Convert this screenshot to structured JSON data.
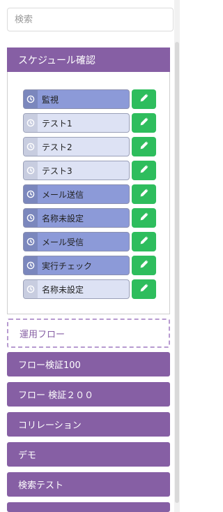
{
  "search": {
    "placeholder": "検索",
    "value": ""
  },
  "schedule": {
    "title": "スケジュール確認",
    "tasks": [
      {
        "label": "監視",
        "state": "active"
      },
      {
        "label": "テスト1",
        "state": "inactive"
      },
      {
        "label": "テスト2",
        "state": "inactive"
      },
      {
        "label": "テスト3",
        "state": "inactive"
      },
      {
        "label": "メール送信",
        "state": "active"
      },
      {
        "label": "名称未設定",
        "state": "active"
      },
      {
        "label": "メール受信",
        "state": "active"
      },
      {
        "label": "実行チェック",
        "state": "active"
      },
      {
        "label": "名称未設定",
        "state": "inactive"
      }
    ]
  },
  "dropzone": {
    "label": "運用フロー"
  },
  "nav": [
    {
      "label": "フロー検証100"
    },
    {
      "label": "フロー 検証２００"
    },
    {
      "label": "コリレーション"
    },
    {
      "label": "デモ"
    },
    {
      "label": "検索テスト"
    }
  ],
  "colors": {
    "header": "#865fa4",
    "task_active": "#8c9ad8",
    "task_inactive": "#dde2f4",
    "edit_button": "#2ebd5d",
    "dashed_border": "#b79ad0"
  },
  "icons": {
    "task": "clock-icon",
    "edit": "pencil-icon"
  }
}
